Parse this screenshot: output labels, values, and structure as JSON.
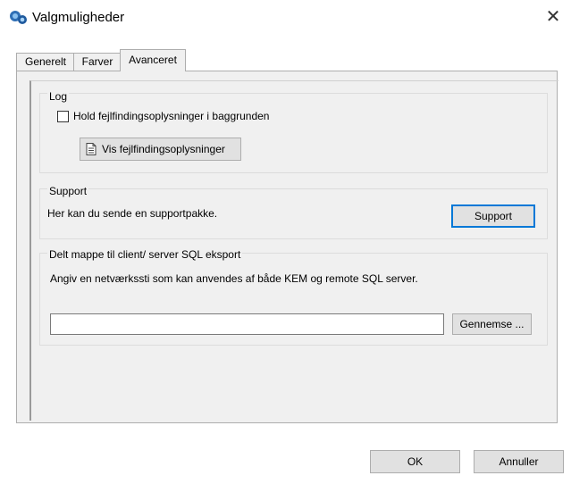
{
  "window": {
    "title": "Valgmuligheder",
    "close_glyph": "✕"
  },
  "tabs": [
    {
      "label": "Generelt",
      "active": false
    },
    {
      "label": "Farver",
      "active": false
    },
    {
      "label": "Avanceret",
      "active": true
    }
  ],
  "log": {
    "title": "Log",
    "checkbox_label": "Hold fejlfindingsoplysninger i baggrunden",
    "checkbox_checked": false,
    "button_label": "Vis fejlfindingsoplysninger",
    "button_icon": "document-icon"
  },
  "support": {
    "title": "Support",
    "description": "Her kan du sende en supportpakke.",
    "button_label": "Support"
  },
  "shared_folder": {
    "title": "Delt mappe til client/ server SQL eksport",
    "description": "Angiv en netværkssti som kan anvendes af både KEM og remote SQL server.",
    "input_value": "",
    "browse_label": "Gennemse ..."
  },
  "footer": {
    "ok_label": "OK",
    "cancel_label": "Annuller"
  },
  "colors": {
    "panel_bg": "#f0f0f0",
    "focus_border": "#0078d7"
  }
}
